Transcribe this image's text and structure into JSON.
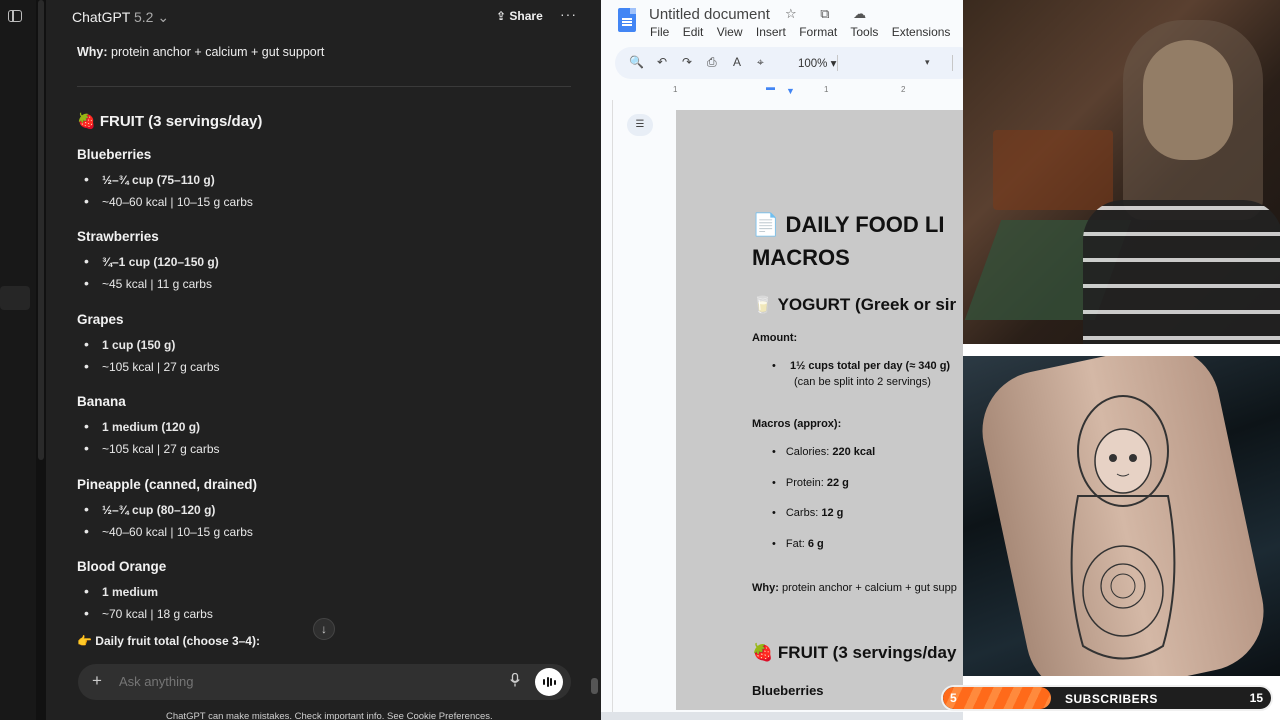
{
  "chat": {
    "model_name": "ChatGPT",
    "model_version": "5.2",
    "share_label": "Share",
    "more_label": "···",
    "why_label": "Why:",
    "why_text": " protein anchor + calcium + gut support",
    "section_emoji": "🍓",
    "section_title": "FRUIT (3 servings/day)",
    "fruits": [
      {
        "name": "Blueberries",
        "amount": "½–¾ cup (75–110 g)",
        "macros": "~40–60 kcal | 10–15 g carbs"
      },
      {
        "name": "Strawberries",
        "amount": "¾–1 cup (120–150 g)",
        "macros": "~45 kcal | 11 g carbs"
      },
      {
        "name": "Grapes",
        "amount": "1 cup (150 g)",
        "macros": "~105 kcal | 27 g carbs"
      },
      {
        "name": "Banana",
        "amount": "1 medium (120 g)",
        "macros": "~105 kcal | 27 g carbs"
      },
      {
        "name": "Pineapple (canned, drained)",
        "amount": "½–¾ cup (80–120 g)",
        "macros": "~40–60 kcal | 10–15 g carbs"
      },
      {
        "name": "Blood Orange",
        "amount": "1 medium",
        "macros": "~70 kcal | 18 g carbs"
      }
    ],
    "daily_total": "👉 Daily fruit total (choose 3–4):",
    "scroll_down_icon": "↓",
    "composer_placeholder": "Ask anything",
    "plus_label": "+",
    "disclaimer": "ChatGPT can make mistakes. Check important info. See Cookie Preferences."
  },
  "docs": {
    "title": "Untitled document",
    "title_icons": "☆ ⧉ ☁",
    "menu": [
      "File",
      "Edit",
      "View",
      "Insert",
      "Format",
      "Tools",
      "Extensions",
      "He"
    ],
    "zoom": "100%",
    "toolbar_icons": [
      "🔍",
      "↶",
      "↷",
      "⎙",
      "A",
      "⌖"
    ],
    "outline_icon": "☰",
    "ruler_marks": [
      "1",
      "1",
      "2"
    ],
    "content": {
      "h1_emoji": "📄",
      "h1_line1": "DAILY FOOD LI",
      "h1_line2": "MACROS",
      "yogurt_emoji": "🥛",
      "yogurt_heading": "YOGURT (Greek or sir",
      "amount_label": "Amount:",
      "amount_item": "1½ cups total per day (≈ 340 g)",
      "amount_note": "(can be split into 2 servings)",
      "macros_label": "Macros (approx):",
      "macros": [
        {
          "label": "Calories: ",
          "value": "220 kcal"
        },
        {
          "label": "Protein: ",
          "value": "22 g"
        },
        {
          "label": "Carbs: ",
          "value": "12 g"
        },
        {
          "label": "Fat: ",
          "value": "6 g"
        }
      ],
      "why_label": "Why:",
      "why_text": " protein anchor + calcium + gut supp",
      "fruit_emoji": "🍓",
      "fruit_heading": "FRUIT (3 servings/day",
      "first_fruit": "Blueberries"
    }
  },
  "overlay": {
    "subscribers_label": "SUBSCRIBERS",
    "current": "5",
    "goal": "15",
    "progress_fraction": 0.33,
    "bar_color": "#ff6a1a"
  }
}
